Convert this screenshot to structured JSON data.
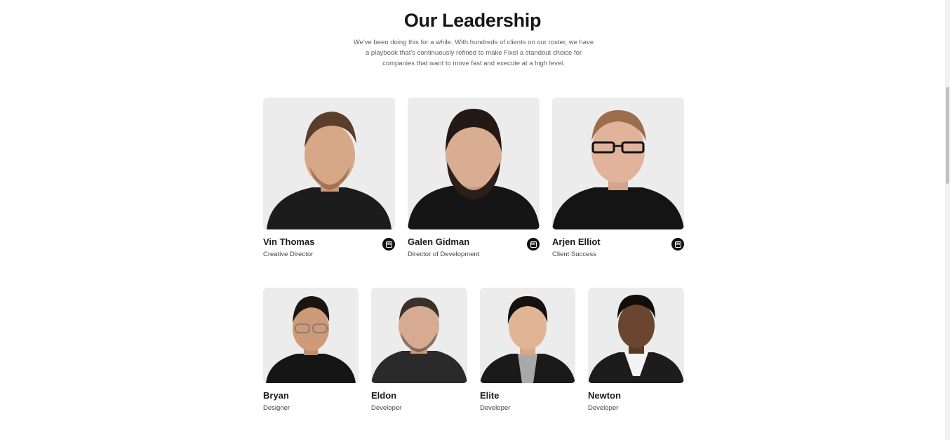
{
  "section": {
    "title": "Our Leadership",
    "subtitle": "We've been doing this for a while. With hundreds of clients on our roster, we have a playbook that's continuously refined to make Fixel a standout choice for companies that want to move fast and execute at a high level."
  },
  "leaders": [
    {
      "name": "Vin Thomas",
      "role": "Creative Director",
      "icon": "linkedin-icon"
    },
    {
      "name": "Galen Gidman",
      "role": "Director of Development",
      "icon": "linkedin-icon"
    },
    {
      "name": "Arjen Elliot",
      "role": "Client Success",
      "icon": "linkedin-icon"
    }
  ],
  "team": [
    {
      "name": "Bryan",
      "role": "Designer"
    },
    {
      "name": "Eldon",
      "role": "Developer"
    },
    {
      "name": "Elite",
      "role": "Developer"
    },
    {
      "name": "Newton",
      "role": "Developer"
    }
  ],
  "colors": {
    "photo_background": "#ececec",
    "text": "#1a1a1a",
    "icon_background": "#111111"
  }
}
